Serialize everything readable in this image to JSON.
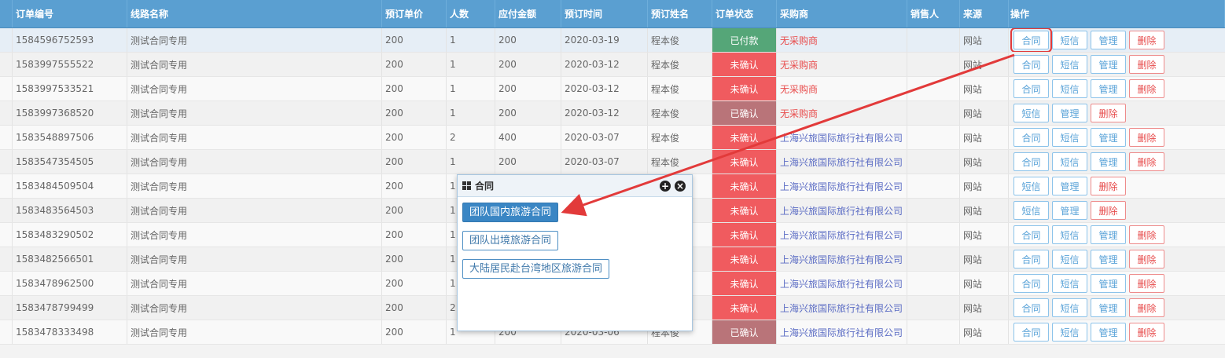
{
  "table": {
    "headers": {
      "id": "订单编号",
      "line": "线路名称",
      "price": "预订单价",
      "num": "人数",
      "pay": "应付金额",
      "date": "预订时间",
      "name": "预订姓名",
      "status": "订单状态",
      "buyer": "采购商",
      "seller": "销售人",
      "src": "来源",
      "ops": "操作"
    },
    "rows": [
      {
        "id": "1584596752593",
        "line": "测试合同专用",
        "price": "200",
        "num": "1",
        "pay": "200",
        "date": "2020-03-19",
        "name": "程本俊",
        "status": "已付款",
        "status_kind": "paid",
        "buyer": "无采购商",
        "buyer_kind": "none",
        "src": "网站",
        "ops": [
          "合同",
          "短信",
          "管理",
          "删除"
        ]
      },
      {
        "id": "1583997555522",
        "line": "测试合同专用",
        "price": "200",
        "num": "1",
        "pay": "200",
        "date": "2020-03-12",
        "name": "程本俊",
        "status": "未确认",
        "status_kind": "unconf",
        "buyer": "无采购商",
        "buyer_kind": "none",
        "src": "网站",
        "ops": [
          "合同",
          "短信",
          "管理",
          "删除"
        ]
      },
      {
        "id": "1583997533521",
        "line": "测试合同专用",
        "price": "200",
        "num": "1",
        "pay": "200",
        "date": "2020-03-12",
        "name": "程本俊",
        "status": "未确认",
        "status_kind": "unconf",
        "buyer": "无采购商",
        "buyer_kind": "none",
        "src": "网站",
        "ops": [
          "合同",
          "短信",
          "管理",
          "删除"
        ]
      },
      {
        "id": "1583997368520",
        "line": "测试合同专用",
        "price": "200",
        "num": "1",
        "pay": "200",
        "date": "2020-03-12",
        "name": "程本俊",
        "status": "已确认",
        "status_kind": "conf",
        "buyer": "无采购商",
        "buyer_kind": "none",
        "src": "网站",
        "ops": [
          "短信",
          "管理",
          "删除"
        ]
      },
      {
        "id": "1583548897506",
        "line": "测试合同专用",
        "price": "200",
        "num": "2",
        "pay": "400",
        "date": "2020-03-07",
        "name": "程本俊",
        "status": "未确认",
        "status_kind": "unconf",
        "buyer": "上海兴旅国际旅行社有限公司",
        "buyer_kind": "agency",
        "src": "网站",
        "ops": [
          "合同",
          "短信",
          "管理",
          "删除"
        ]
      },
      {
        "id": "1583547354505",
        "line": "测试合同专用",
        "price": "200",
        "num": "1",
        "pay": "200",
        "date": "2020-03-07",
        "name": "程本俊",
        "status": "未确认",
        "status_kind": "unconf",
        "buyer": "上海兴旅国际旅行社有限公司",
        "buyer_kind": "agency",
        "src": "网站",
        "ops": [
          "合同",
          "短信",
          "管理",
          "删除"
        ]
      },
      {
        "id": "1583484509504",
        "line": "测试合同专用",
        "price": "200",
        "num": "1",
        "pay": "",
        "date": "",
        "name": "",
        "status": "未确认",
        "status_kind": "unconf",
        "buyer": "上海兴旅国际旅行社有限公司",
        "buyer_kind": "agency",
        "src": "网站",
        "ops": [
          "短信",
          "管理",
          "删除"
        ]
      },
      {
        "id": "1583483564503",
        "line": "测试合同专用",
        "price": "200",
        "num": "1",
        "pay": "",
        "date": "",
        "name": "",
        "status": "未确认",
        "status_kind": "unconf",
        "buyer": "上海兴旅国际旅行社有限公司",
        "buyer_kind": "agency",
        "src": "网站",
        "ops": [
          "短信",
          "管理",
          "删除"
        ]
      },
      {
        "id": "1583483290502",
        "line": "测试合同专用",
        "price": "200",
        "num": "1",
        "pay": "",
        "date": "",
        "name": "",
        "status": "未确认",
        "status_kind": "unconf",
        "buyer": "上海兴旅国际旅行社有限公司",
        "buyer_kind": "agency",
        "src": "网站",
        "ops": [
          "合同",
          "短信",
          "管理",
          "删除"
        ]
      },
      {
        "id": "1583482566501",
        "line": "测试合同专用",
        "price": "200",
        "num": "1",
        "pay": "",
        "date": "",
        "name": "",
        "status": "未确认",
        "status_kind": "unconf",
        "buyer": "上海兴旅国际旅行社有限公司",
        "buyer_kind": "agency",
        "src": "网站",
        "ops": [
          "合同",
          "短信",
          "管理",
          "删除"
        ]
      },
      {
        "id": "1583478962500",
        "line": "测试合同专用",
        "price": "200",
        "num": "1",
        "pay": "",
        "date": "",
        "name": "",
        "status": "未确认",
        "status_kind": "unconf",
        "buyer": "上海兴旅国际旅行社有限公司",
        "buyer_kind": "agency",
        "src": "网站",
        "ops": [
          "合同",
          "短信",
          "管理",
          "删除"
        ]
      },
      {
        "id": "1583478799499",
        "line": "测试合同专用",
        "price": "200",
        "num": "2",
        "pay": "",
        "date": "",
        "name": "",
        "status": "未确认",
        "status_kind": "unconf",
        "buyer": "上海兴旅国际旅行社有限公司",
        "buyer_kind": "agency",
        "src": "网站",
        "ops": [
          "合同",
          "短信",
          "管理",
          "删除"
        ]
      },
      {
        "id": "1583478333498",
        "line": "测试合同专用",
        "price": "200",
        "num": "1",
        "pay": "200",
        "date": "2020-03-06",
        "name": "程本俊",
        "status": "已确认",
        "status_kind": "conf",
        "buyer": "上海兴旅国际旅行社有限公司",
        "buyer_kind": "agency",
        "src": "网站",
        "ops": [
          "合同",
          "短信",
          "管理",
          "删除"
        ]
      }
    ]
  },
  "popup": {
    "title": "合同",
    "options": [
      "团队国内旅游合同",
      "团队出境旅游合同",
      "大陆居民赴台湾地区旅游合同"
    ]
  },
  "colors": {
    "header": "#5a9fd1",
    "paid": "#55a678",
    "unconfirmed": "#f05b5f",
    "confirmed": "#b97479",
    "annotation": "#e23a3a"
  }
}
